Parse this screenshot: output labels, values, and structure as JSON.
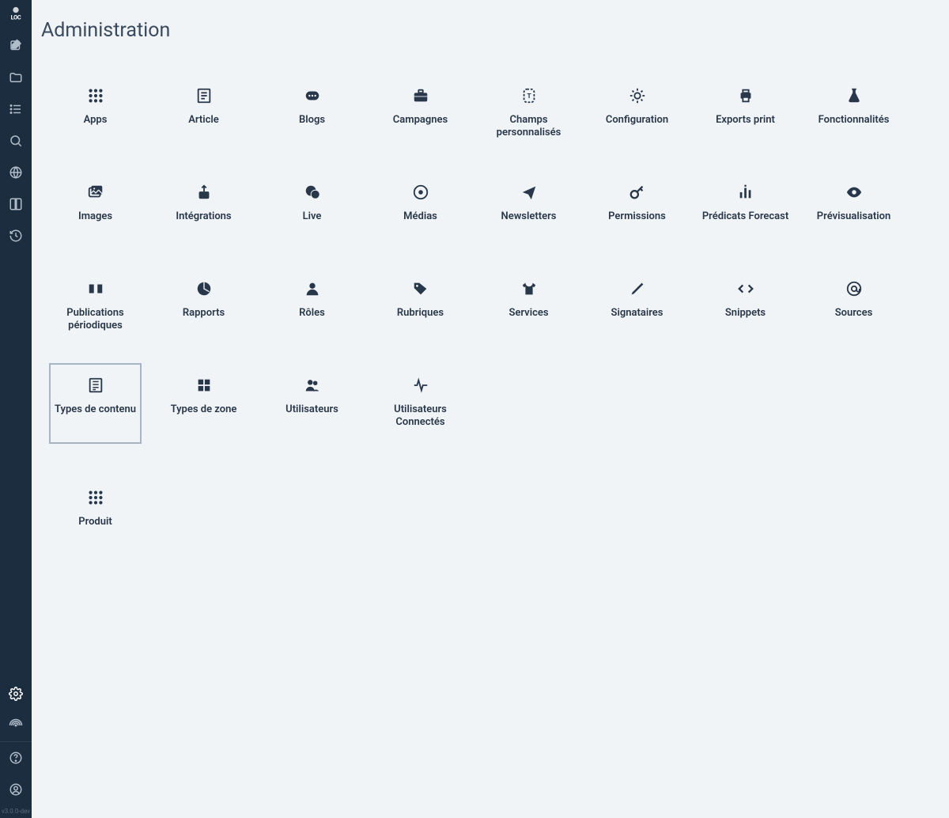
{
  "app": {
    "logo_text": "LOC",
    "version": "v3.0.0-dev"
  },
  "sidebar": {
    "nav": [
      {
        "name": "compose-icon"
      },
      {
        "name": "folder-icon"
      },
      {
        "name": "list-icon"
      },
      {
        "name": "search-icon"
      },
      {
        "name": "globe-icon"
      },
      {
        "name": "book-icon"
      },
      {
        "name": "history-icon"
      }
    ],
    "bottom": [
      {
        "name": "settings-icon",
        "active": true
      },
      {
        "name": "broadcast-icon"
      },
      {
        "name": "help-icon"
      },
      {
        "name": "user-icon"
      }
    ]
  },
  "page": {
    "title": "Administration"
  },
  "tiles": [
    {
      "label": "Apps",
      "icon": "apps-icon"
    },
    {
      "label": "Article",
      "icon": "article-icon"
    },
    {
      "label": "Blogs",
      "icon": "blogs-icon"
    },
    {
      "label": "Campagnes",
      "icon": "briefcase-icon"
    },
    {
      "label": "Champs personnalisés",
      "icon": "custom-fields-icon"
    },
    {
      "label": "Configuration",
      "icon": "gear-icon"
    },
    {
      "label": "Exports print",
      "icon": "print-icon"
    },
    {
      "label": "Fonctionnalités",
      "icon": "flask-icon"
    },
    {
      "label": "Images",
      "icon": "images-icon"
    },
    {
      "label": "Intégrations",
      "icon": "upload-icon"
    },
    {
      "label": "Live",
      "icon": "chat-icon"
    },
    {
      "label": "Médias",
      "icon": "media-icon"
    },
    {
      "label": "Newsletters",
      "icon": "send-icon"
    },
    {
      "label": "Permissions",
      "icon": "key-icon"
    },
    {
      "label": "Prédicats Forecast",
      "icon": "bars-icon"
    },
    {
      "label": "Prévisualisation",
      "icon": "eye-icon"
    },
    {
      "label": "Publications périodiques",
      "icon": "publication-icon"
    },
    {
      "label": "Rapports",
      "icon": "pie-icon"
    },
    {
      "label": "Rôles",
      "icon": "role-icon"
    },
    {
      "label": "Rubriques",
      "icon": "tag-icon"
    },
    {
      "label": "Services",
      "icon": "tshirt-icon"
    },
    {
      "label": "Signataires",
      "icon": "pen-icon"
    },
    {
      "label": "Snippets",
      "icon": "code-icon"
    },
    {
      "label": "Sources",
      "icon": "at-icon"
    },
    {
      "label": "Types de contenu",
      "icon": "content-type-icon",
      "selected": true
    },
    {
      "label": "Types de zone",
      "icon": "grid-icon"
    },
    {
      "label": "Utilisateurs",
      "icon": "users-icon"
    },
    {
      "label": "Utilisateurs Connectés",
      "icon": "activity-icon"
    }
  ],
  "extra_tiles": [
    {
      "label": "Produit",
      "icon": "apps-icon"
    }
  ]
}
